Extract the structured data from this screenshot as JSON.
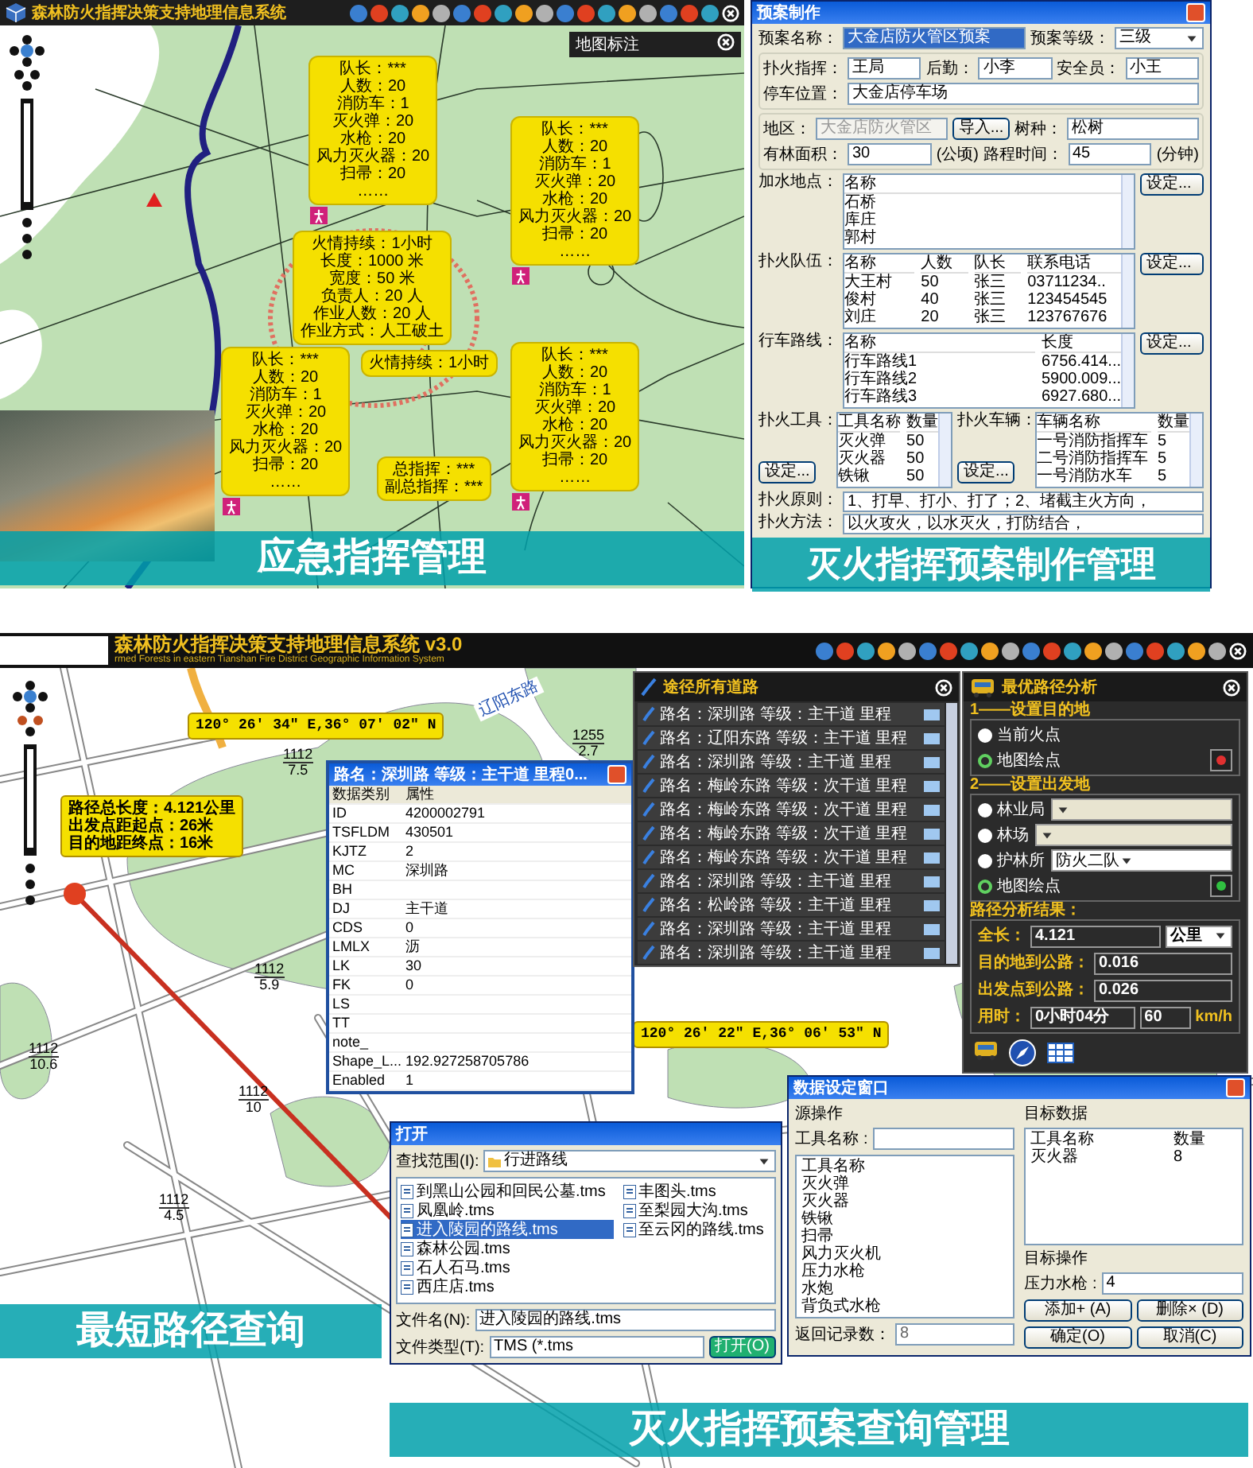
{
  "emergency_panel": {
    "title": "森林防火指挥决策支持地理信息系统",
    "label_panel": "地图标注",
    "team_callouts": [
      {
        "lines": [
          "队长：***",
          "人数：20",
          "消防车：1",
          "灭火弹：20",
          "水枪：20",
          "风力灭火器：20",
          "扫帚：20",
          "……"
        ]
      },
      {
        "lines": [
          "队长：***",
          "人数：20",
          "消防车：1",
          "灭火弹：20",
          "水枪：20",
          "风力灭火器：20",
          "扫帚：20",
          "……"
        ]
      },
      {
        "lines": [
          "队长：***",
          "人数：20",
          "消防车：1",
          "灭火弹：20",
          "水枪：20",
          "风力灭火器：20",
          "扫帚：20",
          "……"
        ]
      },
      {
        "lines": [
          "队长：***",
          "人数：20",
          "消防车：1",
          "灭火弹：20",
          "水枪：20",
          "风力灭火器：20",
          "扫帚：20",
          "……"
        ]
      }
    ],
    "fire_callout": [
      "火情持续：1小时",
      "长度：1000 米",
      "宽度：50 米",
      "负责人：20 人",
      "作业人数：20 人",
      "作业方式：人工破土"
    ],
    "fire_tag": "火情持续：1小时",
    "command_callout": [
      "总指挥：***",
      "副总指挥：***"
    ],
    "caption": "应急指挥管理"
  },
  "plan_editor": {
    "title": "预案制作",
    "plan_name": {
      "label": "预案名称：",
      "value": "大金店防火管区预案"
    },
    "plan_level": {
      "label": "预案等级：",
      "value": "三级"
    },
    "commander": {
      "label": "扑火指挥：",
      "value": "王局"
    },
    "logistics": {
      "label": "后勤：",
      "value": "小李"
    },
    "safety_officer": {
      "label": "安全员：",
      "value": "小王"
    },
    "parking": {
      "label": "停车位置：",
      "value": "大金店停车场"
    },
    "district": {
      "label": "地区：",
      "value": "大金店防火管区",
      "disabled": true
    },
    "import_button": "导入...",
    "tree_species": {
      "label": "树种：",
      "value": "松树"
    },
    "forest_area": {
      "label": "有林面积：",
      "value": "30",
      "unit": "(公顷)"
    },
    "travel_time": {
      "label": "路程时间：",
      "value": "45",
      "unit": "(分钟)"
    },
    "lists": [
      {
        "label": "加水地点：",
        "columns": [
          "名称"
        ],
        "rows": [
          [
            "石桥"
          ],
          [
            "库庄"
          ],
          [
            "郭村"
          ]
        ],
        "button": "设定..."
      },
      {
        "label": "扑火队伍：",
        "columns": [
          "名称",
          "人数",
          "队长",
          "联系电话"
        ],
        "rows": [
          [
            "大王村",
            "50",
            "张三",
            "03711234.."
          ],
          [
            "俊村",
            "40",
            "张三",
            "123454545"
          ],
          [
            "刘庄",
            "20",
            "张三",
            "123767676"
          ]
        ],
        "button": "设定..."
      },
      {
        "label": "行车路线：",
        "columns": [
          "名称",
          "长度"
        ],
        "rows": [
          [
            "行车路线1",
            "6756.414..."
          ],
          [
            "行车路线2",
            "5900.009..."
          ],
          [
            "行车路线3",
            "6927.680..."
          ]
        ],
        "button": "设定..."
      }
    ],
    "tools": {
      "label": "扑火工具：",
      "columns": [
        "工具名称",
        "数量"
      ],
      "rows": [
        [
          "灭火弹",
          "50"
        ],
        [
          "灭火器",
          "50"
        ],
        [
          "铁锹",
          "50"
        ]
      ],
      "button": "设定..."
    },
    "vehicles": {
      "label": "扑火车辆：",
      "columns": [
        "车辆名称",
        "数量"
      ],
      "rows": [
        [
          "一号消防指挥车",
          "5"
        ],
        [
          "二号消防指挥车",
          "5"
        ],
        [
          "一号消防水车",
          "5"
        ]
      ],
      "button": "设定..."
    },
    "principle": {
      "label": "扑火原则：",
      "text": "1、打早、打小、打了；2、堵截主火方向，"
    },
    "method": {
      "label": "扑火方法：",
      "text": "以火攻火，以水灭火，打防结合，"
    },
    "caption": "灭火指挥预案制作管理"
  },
  "route_query": {
    "title": "森林防火指挥决策支持地理信息系统 v3.0",
    "subtitle": "rmed Forests in eastern Tianshan Fire District Geographic Information System",
    "road_labels": [
      "辽阳东路"
    ],
    "parcel_labels": [
      {
        "code": "1255",
        "area": "2.7"
      },
      {
        "code": "1112",
        "area": "7.5"
      },
      {
        "code": "1112",
        "area": "5.9"
      },
      {
        "code": "1112",
        "area": "10"
      },
      {
        "code": "1112",
        "area": "10.6"
      },
      {
        "code": "1112",
        "area": "4.5"
      }
    ],
    "coordinate_tags": [
      "120° 26′ 34″ E,36° 07′ 02″ N",
      "120° 26′ 22″ E,36° 06′ 53″ N"
    ],
    "route_summary": [
      "路径总长度：4.121公里",
      "出发点距起点：26米",
      "目的地距终点：16米"
    ],
    "attribute_window": {
      "title": "路名：深圳路 等级：主干道 里程0...",
      "columns": [
        "数据类别",
        "属性"
      ],
      "rows": [
        {
          "key": "ID",
          "value": "4200002791"
        },
        {
          "key": "TSFLDM",
          "value": "430501"
        },
        {
          "key": "KJTZ",
          "value": "2"
        },
        {
          "key": "MC",
          "value": "深圳路"
        },
        {
          "key": "BH"
        },
        {
          "key": "DJ",
          "value": "主干道"
        },
        {
          "key": "CDS",
          "value": "0"
        },
        {
          "key": "LMLX",
          "value": "沥"
        },
        {
          "key": "LK",
          "value": "30"
        },
        {
          "key": "FK",
          "value": "0"
        },
        {
          "key": "LS"
        },
        {
          "key": "TT"
        },
        {
          "key": "note_"
        },
        {
          "key": "Shape_L...",
          "value": "192.927258705786"
        },
        {
          "key": "Enabled",
          "value": "1"
        }
      ]
    },
    "road_list": {
      "title": "途径所有道路",
      "rows": [
        "路名：深圳路 等级：主干道 里程",
        "路名：辽阳东路 等级：主干道 里程",
        "路名：深圳路 等级：主干道 里程",
        "路名：梅岭东路 等级：次干道 里程",
        "路名：梅岭东路 等级：次干道 里程",
        "路名：梅岭东路 等级：次干道 里程",
        "路名：梅岭东路 等级：次干道 里程",
        "路名：深圳路 等级：主干道 里程",
        "路名：松岭路 等级：主干道 里程",
        "路名：深圳路 等级：主干道 里程",
        "路名：深圳路 等级：主干道 里程"
      ]
    },
    "path_panel": {
      "title": "最优路径分析",
      "sections": [
        {
          "title": "1——设置目的地",
          "options": [
            {
              "label": "当前火点",
              "selected": false,
              "kind": "plain"
            },
            {
              "label": "地图绘点",
              "selected": true,
              "kind": "pick"
            }
          ]
        },
        {
          "title": "2——设置出发地",
          "options": [
            {
              "label": "林业局",
              "selected": false,
              "kind": "dropdown",
              "disabled": true
            },
            {
              "label": "林场",
              "selected": false,
              "kind": "dropdown",
              "disabled": true
            },
            {
              "label": "护林所",
              "selected": false,
              "kind": "dropdown",
              "disabled": false,
              "value": "防火二队"
            },
            {
              "label": "地图绘点",
              "selected": true,
              "kind": "pick"
            }
          ]
        }
      ],
      "result_title": "路径分析结果：",
      "total": {
        "label": "全长：",
        "value": "4.121",
        "unit": "公里"
      },
      "dest_to_road": {
        "label": "目的地到公路：",
        "value": "0.016"
      },
      "start_to_road": {
        "label": "出发点到公路：",
        "value": "0.026"
      },
      "time": {
        "label": "用时：",
        "value": "0小时04分",
        "speed": "60",
        "unit": "km/h"
      }
    },
    "open_dialog": {
      "title": "打开",
      "look_in_label": "查找范围(I):",
      "look_in": "行进路线",
      "files": [
        {
          "name": "到黑山公园和回民公墓.tms",
          "selected": false
        },
        {
          "name": "凤凰岭.tms",
          "selected": false
        },
        {
          "name": "进入陵园的路线.tms",
          "selected": true
        },
        {
          "name": "森林公园.tms",
          "selected": false
        },
        {
          "name": "石人石马.tms",
          "selected": false
        },
        {
          "name": "西庄店.tms",
          "selected": false
        },
        {
          "name": "丰图头.tms",
          "selected": false
        },
        {
          "name": "至梨园大沟.tms",
          "selected": false
        },
        {
          "name": "至云冈的路线.tms",
          "selected": false
        }
      ],
      "file_name_label": "文件名(N):",
      "file_name": "进入陵园的路线.tms",
      "file_type_label": "文件类型(T):",
      "file_type": "TMS (*.tms",
      "open_button": "打开(O)"
    },
    "data_window": {
      "title": "数据设定窗口",
      "source_title": "源操作",
      "search_label": "工具名称",
      "search_colon": ":",
      "source_column": "工具名称",
      "source_rows": [
        "灭火弹",
        "灭火器",
        "铁锹",
        "扫帚",
        "风力灭火机",
        "压力水枪",
        "水炮",
        "背负式水枪"
      ],
      "count_label": "返回记录数：",
      "count": "8",
      "target_title": "目标数据",
      "target_columns": [
        "工具名称",
        "数量"
      ],
      "target_rows": [
        [
          "灭火器",
          "8"
        ]
      ],
      "op_title": "目标操作",
      "op_label": "压力水枪",
      "op_colon": ":",
      "op_value": "4",
      "buttons": [
        "添加+ (A)",
        "删除× (D)",
        "确定(O)",
        "取消(C)"
      ]
    },
    "captions": [
      "最短路径查询",
      "灭火指挥预案查询管理"
    ]
  }
}
